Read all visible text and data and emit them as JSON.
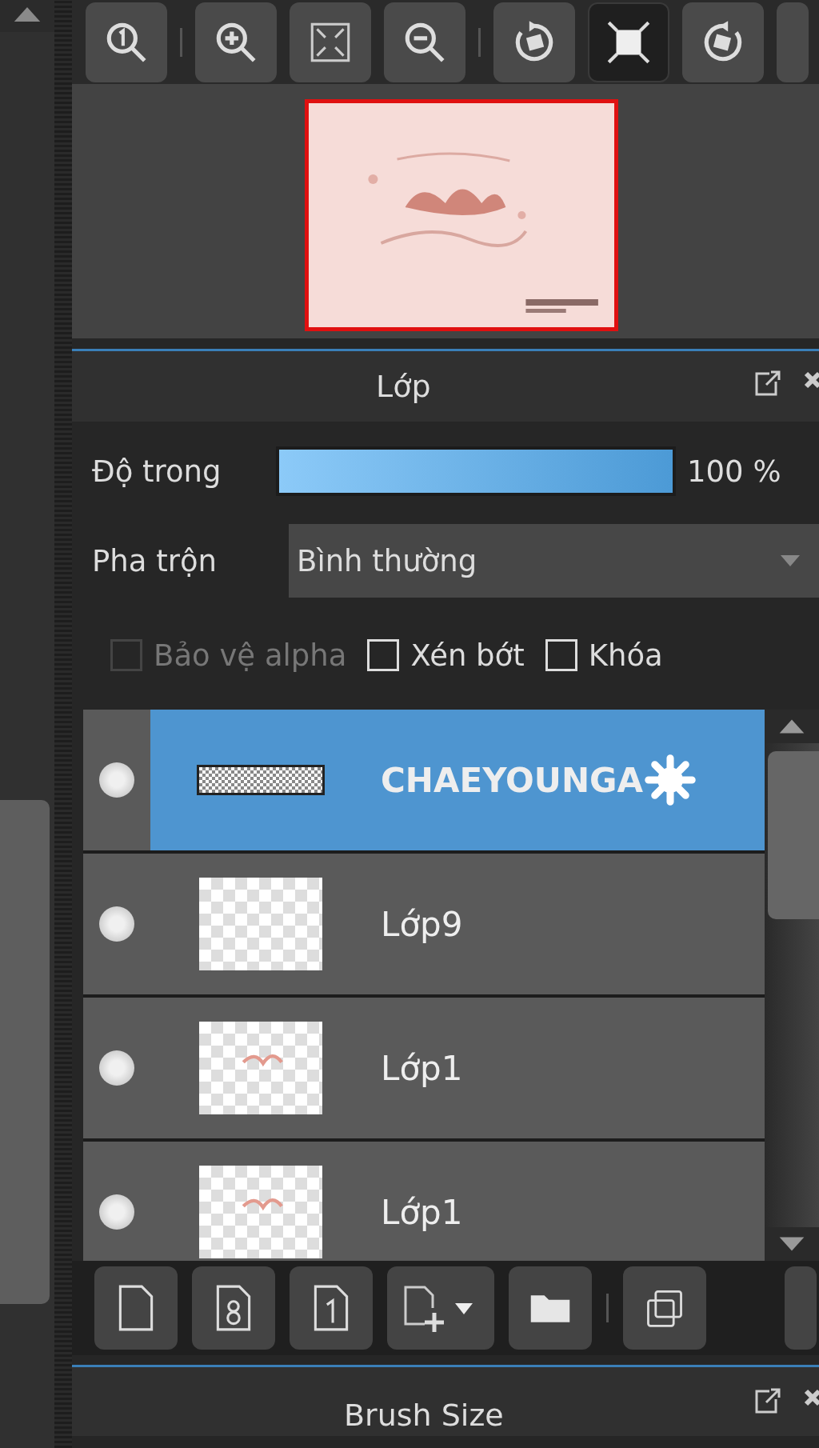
{
  "toolbar": {
    "buttons": [
      {
        "kind": "zoom-actual",
        "selected": false
      },
      {
        "kind": "separator"
      },
      {
        "kind": "zoom-in",
        "selected": false
      },
      {
        "kind": "fit",
        "selected": false
      },
      {
        "kind": "zoom-out",
        "selected": false
      },
      {
        "kind": "separator"
      },
      {
        "kind": "rotate-left",
        "selected": false
      },
      {
        "kind": "fit-window",
        "selected": true
      },
      {
        "kind": "rotate-right",
        "selected": false
      },
      {
        "kind": "cut-off",
        "selected": false
      }
    ]
  },
  "layers_panel": {
    "title": "Lớp",
    "opacity": {
      "label": "Độ trong",
      "level": 1,
      "reading": "100 %"
    },
    "blend": {
      "label": "Pha trộn",
      "value": "Bình thường"
    },
    "options": [
      {
        "label": "Bảo vệ alpha",
        "checked": false,
        "disabled": true
      },
      {
        "label": "Xén bớt",
        "checked": false,
        "disabled": false
      },
      {
        "label": "Khóa",
        "checked": false,
        "disabled": false
      }
    ],
    "layers": [
      {
        "name": "CHAEYOUNGA",
        "selected": true,
        "kind": "strip",
        "badge": true
      },
      {
        "name": "Lớp9",
        "selected": false,
        "kind": "blank",
        "badge": false
      },
      {
        "name": "Lớp1",
        "selected": false,
        "kind": "sketch",
        "badge": false
      },
      {
        "name": "Lớp1",
        "selected": false,
        "kind": "sketch",
        "badge": false
      }
    ],
    "actions": [
      {
        "kind": "new-layer"
      },
      {
        "kind": "new-8bit-layer"
      },
      {
        "kind": "new-1bit-layer"
      },
      {
        "kind": "add-menu"
      },
      {
        "kind": "folder"
      },
      {
        "kind": "separator"
      },
      {
        "kind": "duplicate"
      },
      {
        "kind": "cut-off"
      }
    ]
  },
  "brush_panel": {
    "title": "Brush Size"
  }
}
